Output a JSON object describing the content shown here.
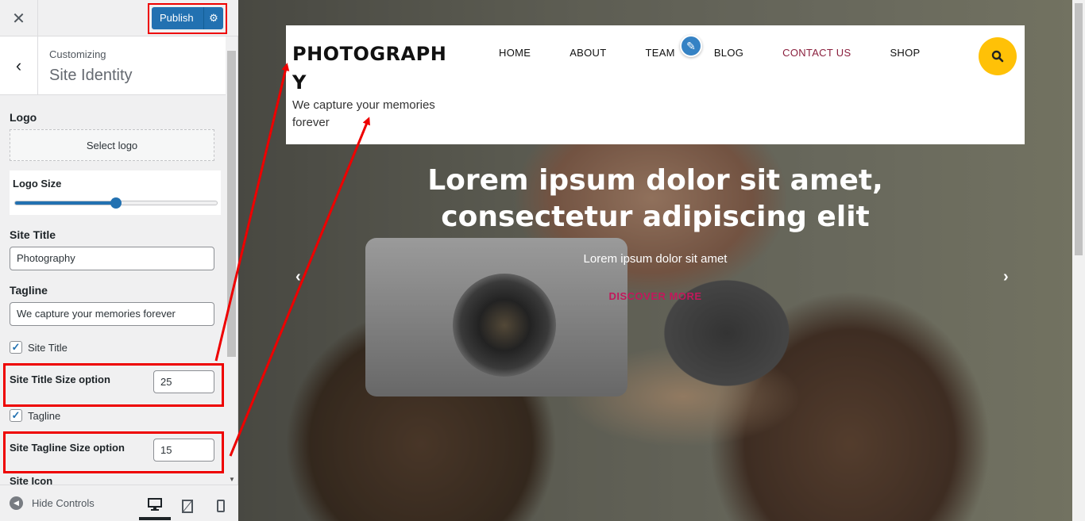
{
  "customizer": {
    "publish_label": "Publish",
    "customizing": "Customizing",
    "section_title": "Site Identity",
    "logo_label": "Logo",
    "select_logo": "Select logo",
    "logo_size_label": "Logo Size",
    "logo_size_fraction": 0.5,
    "site_title_label": "Site Title",
    "site_title_value": "Photography",
    "tagline_label": "Tagline",
    "tagline_value": "We capture your memories forever",
    "show_site_title_label": "Site Title",
    "show_site_title_checked": true,
    "title_size_label": "Site Title Size option",
    "title_size_value": "25",
    "show_tagline_label": "Tagline",
    "show_tagline_checked": true,
    "tagline_size_label": "Site Tagline Size option",
    "tagline_size_value": "15",
    "site_icon_label": "Site Icon",
    "hide_controls": "Hide Controls",
    "accent_color": "#2271b1"
  },
  "site": {
    "title": "PHOTOGRAPHY",
    "tagline": "We capture your memories forever",
    "nav": [
      "HOME",
      "ABOUT",
      "TEAM",
      "BLOG",
      "CONTACT US",
      "SHOP"
    ],
    "active_nav": "CONTACT US",
    "search_color": "#ffc107"
  },
  "hero": {
    "title": "Lorem ipsum dolor sit amet, consectetur adipiscing elit",
    "subtitle": "Lorem ipsum dolor sit amet",
    "cta": "DISCOVER MORE",
    "cta_color": "#c2185b"
  },
  "icons": {
    "close": "close-icon",
    "settings": "gear-icon",
    "back": "chevron-left-icon",
    "edit": "pencil-icon",
    "search": "search-icon",
    "desktop": "desktop-icon",
    "tablet": "tablet-icon",
    "mobile": "mobile-icon"
  }
}
